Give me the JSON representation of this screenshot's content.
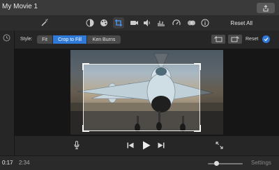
{
  "window": {
    "title": "My Movie 1"
  },
  "toolbar": {
    "icons": [
      "magic-wand-icon",
      "color-balance-icon",
      "palette-icon",
      "crop-icon",
      "video-camera-icon",
      "volume-icon",
      "equalizer-icon",
      "speedometer-icon",
      "filter-icon",
      "info-icon"
    ],
    "active": "crop-icon",
    "reset_all_label": "Reset All"
  },
  "style_bar": {
    "label": "Style:",
    "options": [
      "Fit",
      "Crop to Fill",
      "Ken Burns"
    ],
    "selected": "Crop to Fill",
    "reset_label": "Reset"
  },
  "playback": {
    "current_time": "0:17",
    "separator": "/",
    "total_time": "2:34",
    "zoom_level": 0.25,
    "settings_label": "Settings"
  },
  "colors": {
    "accent": "#2f79d8"
  }
}
